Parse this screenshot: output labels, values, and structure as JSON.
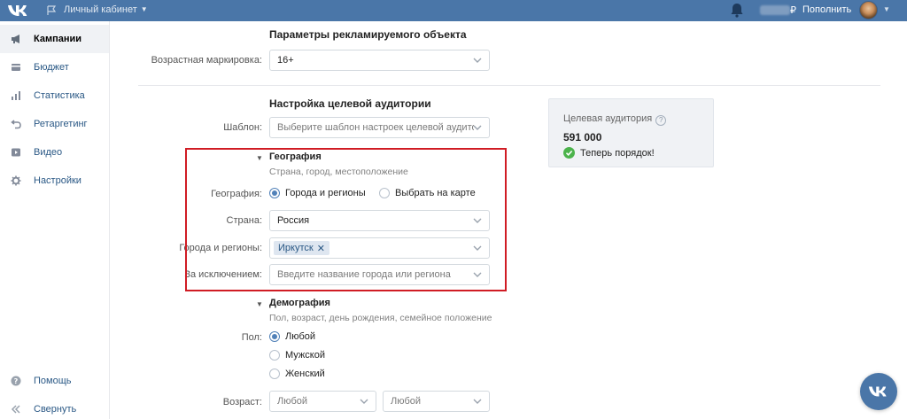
{
  "topbar": {
    "cabinet_label": "Личный кабинет",
    "currency_symbol": "₽",
    "topup_label": "Пополнить"
  },
  "sidebar": {
    "items": [
      {
        "label": "Кампании",
        "icon": "megaphone-icon",
        "active": true
      },
      {
        "label": "Бюджет",
        "icon": "wallet-icon"
      },
      {
        "label": "Статистика",
        "icon": "bar-chart-icon"
      },
      {
        "label": "Ретаргетинг",
        "icon": "retarget-icon"
      },
      {
        "label": "Видео",
        "icon": "video-icon"
      },
      {
        "label": "Настройки",
        "icon": "gear-icon"
      }
    ],
    "help_label": "Помощь",
    "collapse_label": "Свернуть"
  },
  "ad_object": {
    "title": "Параметры рекламируемого объекта",
    "age_label": "Возрастная маркировка:",
    "age_value": "16+"
  },
  "audience_setup": {
    "title": "Настройка целевой аудитории",
    "template_label": "Шаблон:",
    "template_placeholder": "Выберите шаблон настроек целевой аудитории..."
  },
  "geography": {
    "title": "География",
    "subtitle": "Страна, город, местоположение",
    "mode_label": "География:",
    "option_cities": "Города и регионы",
    "option_map": "Выбрать на карте",
    "country_label": "Страна:",
    "country_value": "Россия",
    "cities_label": "Города и регионы:",
    "cities_tags": [
      "Иркутск"
    ],
    "exclude_label": "За исключением:",
    "exclude_placeholder": "Введите название города или региона"
  },
  "demography": {
    "title": "Демография",
    "subtitle": "Пол, возраст, день рождения, семейное положение",
    "gender_label": "Пол:",
    "gender_options": [
      "Любой",
      "Мужской",
      "Женский"
    ],
    "age_label": "Возраст:",
    "age_from": "Любой",
    "age_to": "Любой"
  },
  "audience_card": {
    "title": "Целевая аудитория",
    "help": "?",
    "count": "591 000",
    "status": "Теперь порядок!"
  },
  "colors": {
    "brand": "#4a76a8",
    "highlight": "#d01c24",
    "success": "#4bb34b"
  }
}
